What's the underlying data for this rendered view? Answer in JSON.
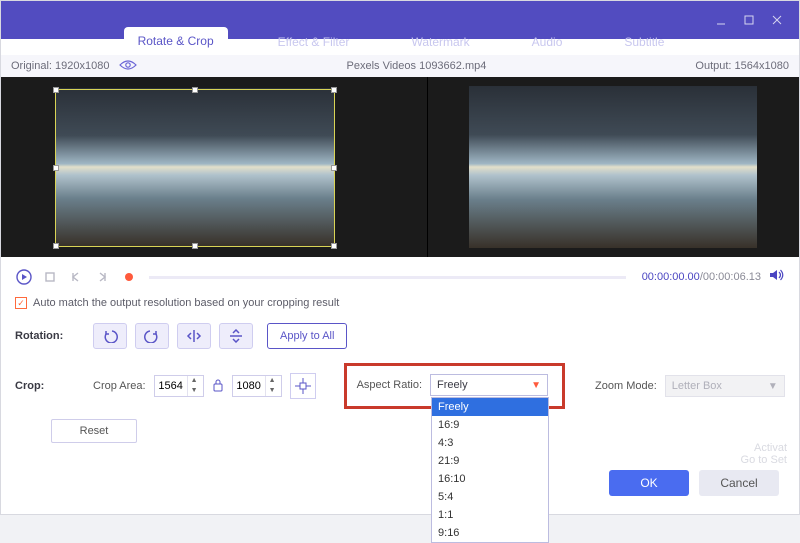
{
  "window": {
    "min": "",
    "max": "",
    "close": ""
  },
  "tabs": {
    "rotate_crop": "Rotate & Crop",
    "effect_filter": "Effect & Filter",
    "watermark": "Watermark",
    "audio": "Audio",
    "subtitle": "Subtitle"
  },
  "subheader": {
    "original_label": "Original:",
    "original_value": "1920x1080",
    "filename": "Pexels Videos 1093662.mp4",
    "output_label": "Output:",
    "output_value": "1564x1080"
  },
  "playback": {
    "current": "00:00:00.00",
    "sep": "/",
    "total": "00:00:06.13"
  },
  "automatch": {
    "checked": true,
    "label": "Auto match the output resolution based on your cropping result"
  },
  "rotation": {
    "label": "Rotation:",
    "apply_all": "Apply to All"
  },
  "crop": {
    "label": "Crop:",
    "area_label": "Crop Area:",
    "width": "1564",
    "height": "1080",
    "reset": "Reset",
    "aspect_label": "Aspect Ratio:",
    "aspect_selected": "Freely",
    "aspect_options": [
      "Freely",
      "16:9",
      "4:3",
      "21:9",
      "16:10",
      "5:4",
      "1:1",
      "9:16"
    ],
    "zoom_label": "Zoom Mode:",
    "zoom_value": "Letter Box"
  },
  "footer": {
    "ok": "OK",
    "cancel": "Cancel"
  },
  "watermark": {
    "line1": "Activat",
    "line2": "Go to Set"
  }
}
